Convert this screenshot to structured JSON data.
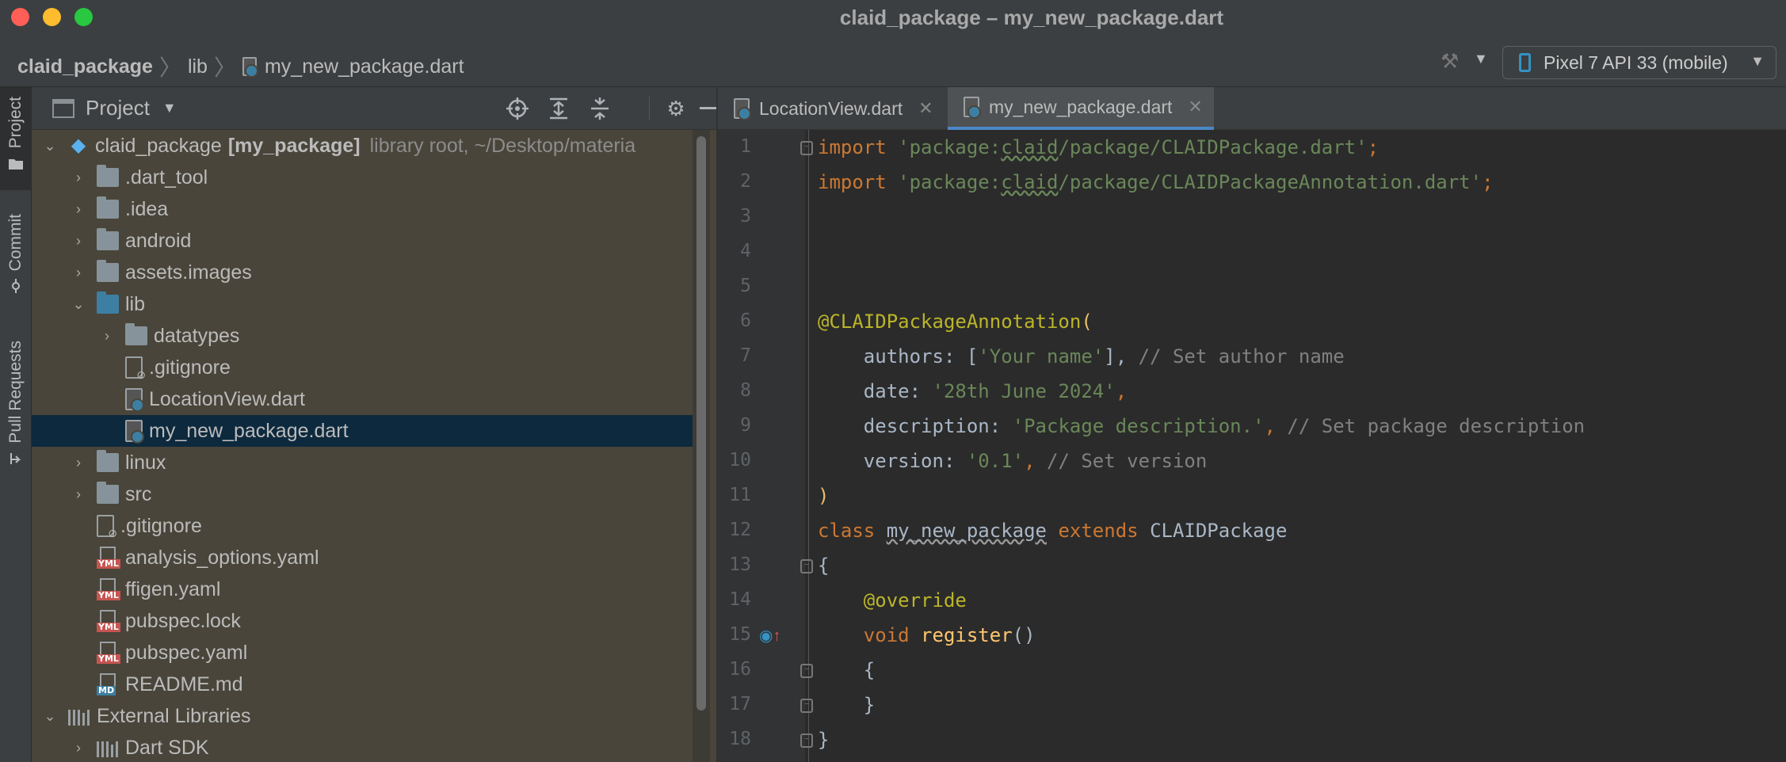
{
  "window": {
    "title": "claid_package – my_new_package.dart"
  },
  "navbar": {
    "crumbs": [
      "claid_package",
      "lib",
      "my_new_package.dart"
    ],
    "device": "Pixel 7 API 33 (mobile)"
  },
  "toolstrip": {
    "tabs": [
      "Project",
      "Commit",
      "Pull Requests"
    ]
  },
  "project_panel": {
    "title": "Project",
    "root": {
      "name": "claid_package",
      "module": "[my_package]",
      "hint": "library root, ~/Desktop/materia"
    },
    "items": [
      {
        "label": ".dart_tool"
      },
      {
        "label": ".idea"
      },
      {
        "label": "android"
      },
      {
        "label": "assets.images"
      },
      {
        "label": "lib"
      },
      {
        "label": "datatypes"
      },
      {
        "label": ".gitignore"
      },
      {
        "label": "LocationView.dart"
      },
      {
        "label": "my_new_package.dart"
      },
      {
        "label": "linux"
      },
      {
        "label": "src"
      },
      {
        "label": ".gitignore"
      },
      {
        "label": "analysis_options.yaml"
      },
      {
        "label": "ffigen.yaml"
      },
      {
        "label": "pubspec.lock"
      },
      {
        "label": "pubspec.yaml"
      },
      {
        "label": "README.md"
      },
      {
        "label": "External Libraries"
      },
      {
        "label": "Dart SDK"
      }
    ],
    "file_tags": {
      "yml": "YML",
      "md": "MD"
    }
  },
  "editor": {
    "tabs": [
      {
        "label": "LocationView.dart"
      },
      {
        "label": "my_new_package.dart"
      }
    ],
    "line_numbers": [
      "1",
      "2",
      "3",
      "4",
      "5",
      "6",
      "7",
      "8",
      "9",
      "10",
      "11",
      "12",
      "13",
      "14",
      "15",
      "16",
      "17",
      "18"
    ],
    "code": {
      "kw_import": "import",
      "kw_class": "class",
      "kw_extends": "extends",
      "kw_void": "void",
      "str_import1_a": "'package:",
      "str_import1_b": "claid",
      "str_import1_c": "/package/CLAIDPackage.dart'",
      "str_import2_c": "/package/CLAIDPackageAnnotation.dart'",
      "semicolon": ";",
      "annotation": "@CLAIDPackageAnnotation",
      "open_paren": "(",
      "close_paren": ")",
      "authors_key": "authors: [",
      "authors_val": "'Your name'",
      "authors_end": "],",
      "authors_cmt": " // Set author name",
      "date_key": "date: ",
      "date_val": "'28th June 2024'",
      "comma": ",",
      "desc_key": "description: ",
      "desc_val": "'Package description.'",
      "desc_cmt": " // Set package description",
      "version_key": "version: ",
      "version_val": "'0.1'",
      "version_cmt": " // Set version",
      "class_name": "my_new_package",
      "base_class": "CLAIDPackage",
      "open_brace": "{",
      "close_brace": "}",
      "override": "@override",
      "method": "register",
      "method_parens": "()"
    }
  },
  "colors": {
    "accent": "#4a88c7",
    "selection": "#0d293e",
    "keyword": "#cc7832",
    "string": "#6a8759",
    "annotation": "#bbb529",
    "function": "#ffc66d",
    "comment": "#808080"
  }
}
